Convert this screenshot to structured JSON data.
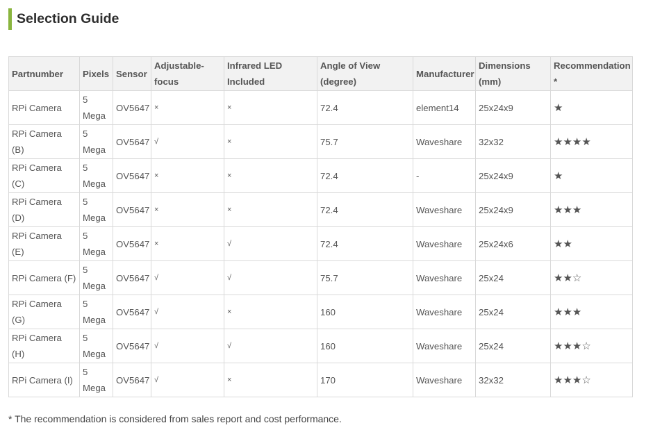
{
  "section_title": "Selection Guide",
  "headers": {
    "partnumber": "Partnumber",
    "pixels": "Pixels",
    "sensor": "Sensor",
    "adjustable_focus": "Adjustable-focus",
    "infrared_led": "Infrared LED Included",
    "angle_of_view": "Angle of View (degree)",
    "manufacturer": "Manufacturer",
    "dimensions": "Dimensions (mm)",
    "recommendation": "Recommendation *"
  },
  "rows": [
    {
      "part": "RPi Camera",
      "pixels": "5 Mega",
      "sensor": "OV5647",
      "focus": "×",
      "ir": "×",
      "angle": "72.4",
      "mfr": "element14",
      "dims": "25x24x9",
      "rec": "★"
    },
    {
      "part": "RPi Camera (B)",
      "pixels": "5 Mega",
      "sensor": "OV5647",
      "focus": "√",
      "ir": "×",
      "angle": "75.7",
      "mfr": "Waveshare",
      "dims": "32x32",
      "rec": "★★★★"
    },
    {
      "part": "RPi Camera (C)",
      "pixels": "5 Mega",
      "sensor": "OV5647",
      "focus": "×",
      "ir": "×",
      "angle": "72.4",
      "mfr": "-",
      "dims": "25x24x9",
      "rec": "★"
    },
    {
      "part": "RPi Camera (D)",
      "pixels": "5 Mega",
      "sensor": "OV5647",
      "focus": "×",
      "ir": "×",
      "angle": "72.4",
      "mfr": "Waveshare",
      "dims": "25x24x9",
      "rec": "★★★"
    },
    {
      "part": "RPi Camera (E)",
      "pixels": "5 Mega",
      "sensor": "OV5647",
      "focus": "×",
      "ir": "√",
      "angle": "72.4",
      "mfr": "Waveshare",
      "dims": "25x24x6",
      "rec": "★★"
    },
    {
      "part": "RPi Camera (F)",
      "pixels": "5 Mega",
      "sensor": "OV5647",
      "focus": "√",
      "ir": "√",
      "angle": "75.7",
      "mfr": "Waveshare",
      "dims": "25x24",
      "rec": "★★☆"
    },
    {
      "part": "RPi Camera (G)",
      "pixels": "5 Mega",
      "sensor": "OV5647",
      "focus": "√",
      "ir": "×",
      "angle": "160",
      "mfr": "Waveshare",
      "dims": "25x24",
      "rec": "★★★"
    },
    {
      "part": "RPi Camera (H)",
      "pixels": "5 Mega",
      "sensor": "OV5647",
      "focus": "√",
      "ir": "√",
      "angle": "160",
      "mfr": "Waveshare",
      "dims": "25x24",
      "rec": "★★★☆"
    },
    {
      "part": "RPi Camera (I)",
      "pixels": "5 Mega",
      "sensor": "OV5647",
      "focus": "√",
      "ir": "×",
      "angle": "170",
      "mfr": "Waveshare",
      "dims": "32x32",
      "rec": "★★★☆"
    }
  ],
  "footnote": "* The recommendation is considered from sales report and cost performance.",
  "colors": {
    "accent_bar": "#8ab53f",
    "header_bg": "#f2f2f2",
    "border": "#d9d9d9"
  }
}
